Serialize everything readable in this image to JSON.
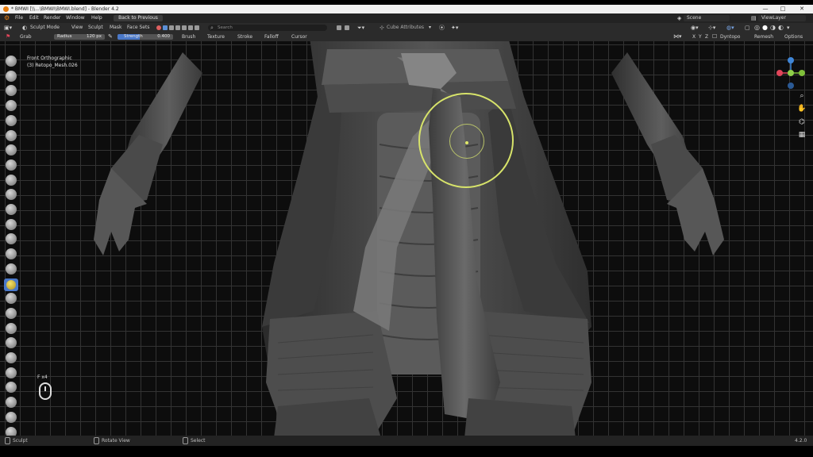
{
  "window": {
    "title": "* BMWI [\\\\...\\BMWI\\BMWI.blend] - Blender 4.2",
    "controls": [
      "—",
      "□",
      "✕"
    ]
  },
  "menubar": {
    "items": [
      "File",
      "Edit",
      "Render",
      "Window",
      "Help"
    ],
    "back_button": "Back to Previous",
    "scene_label": "Scene",
    "view_layer_label": "ViewLayer"
  },
  "header": {
    "mode": "Sculpt Mode",
    "menus": [
      "View",
      "Sculpt",
      "Mask",
      "Face Sets"
    ],
    "search_placeholder": "Search",
    "snap_label": "Cube Attributes"
  },
  "tool_settings": {
    "tool_name": "Grab",
    "radius_label": "Radius",
    "radius_value": "120 px",
    "strength_label": "Strength",
    "strength_value": "0.400",
    "strength_fraction": 0.4,
    "dropdowns": [
      "Brush",
      "Texture",
      "Stroke",
      "Falloff",
      "Cursor"
    ],
    "right_items": [
      "Dyntopo",
      "Remesh",
      "Options"
    ]
  },
  "viewport": {
    "view_name": "Front Orthographic",
    "object_name": "(3) Retopo_Mesh.026",
    "key_hint": "F x4"
  },
  "statusbar": {
    "items": [
      "Sculpt",
      "Rotate View",
      "Select"
    ],
    "version": "4.2.0"
  },
  "colors": {
    "brush_circle": "#d7e36a",
    "active_tool": "#4a78c8",
    "strength_slider": "#4a78c8",
    "gizmo_x": "#e0455a",
    "gizmo_y": "#7fbf3a",
    "gizmo_z": "#3f86d8"
  },
  "icons": {
    "toolbar": [
      "draw-brush-icon",
      "draw-sharp-icon",
      "clay-icon",
      "clay-strips-icon",
      "clay-thumb-icon",
      "layer-icon",
      "inflate-icon",
      "blob-icon",
      "crease-icon",
      "smooth-icon",
      "flatten-icon",
      "fill-icon",
      "scrape-icon",
      "multiplane-scrape-icon",
      "pinch-icon",
      "grab-icon",
      "elastic-deform-icon",
      "snake-hook-icon",
      "thumb-icon",
      "pose-icon",
      "nudge-icon",
      "rotate-icon",
      "slide-relax-icon",
      "boundary-icon",
      "cloth-icon",
      "simplify-icon",
      "mask-icon"
    ],
    "nav": [
      "zoom-icon",
      "pan-hand-icon",
      "camera-icon",
      "grid-icon"
    ]
  }
}
